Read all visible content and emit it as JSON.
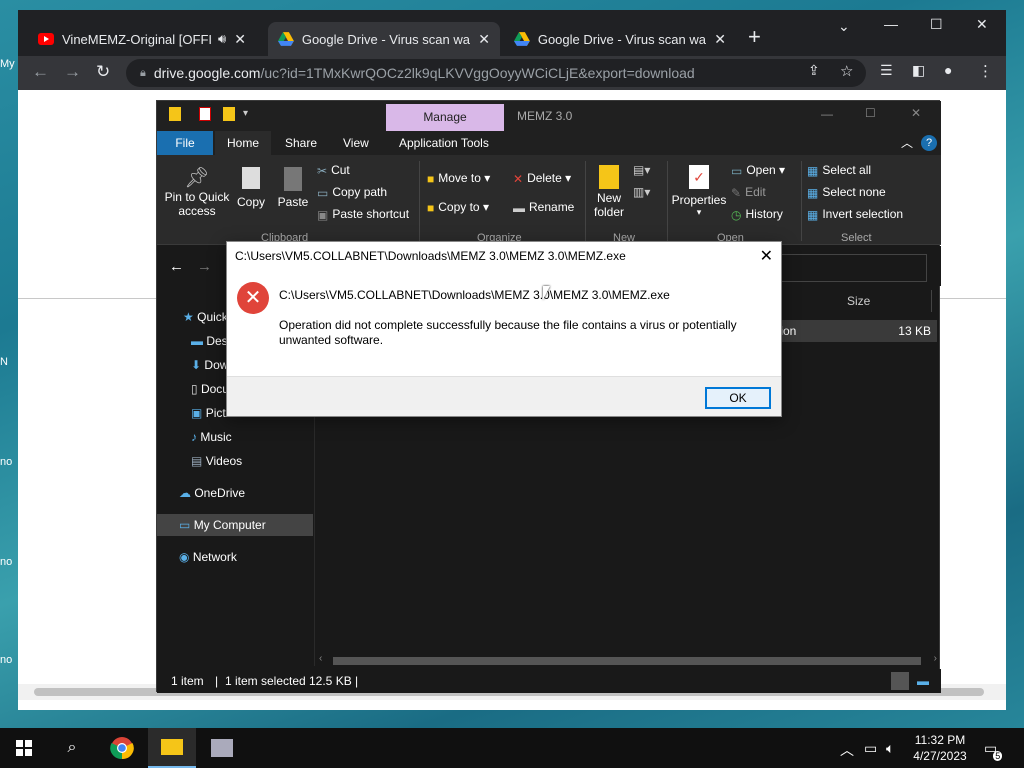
{
  "desktop": {
    "icon_labels": [
      "My",
      "N",
      "no",
      "no",
      "no"
    ]
  },
  "browser": {
    "tabs": [
      {
        "title": "VineMEMZ-Original [OFFICIAL",
        "icon": "youtube-icon",
        "audio": "speaker-icon"
      },
      {
        "title": "Google Drive - Virus scan warning",
        "icon": "google-drive-icon"
      },
      {
        "title": "Google Drive - Virus scan warning",
        "icon": "google-drive-icon"
      }
    ],
    "new_tab": "+",
    "url_host": "drive.google.com",
    "url_rest": "/uc?id=1TMxKwrQOCz2lk9qLKVVggOoyyWCiCLjE&export=download"
  },
  "explorer": {
    "title": "MEMZ 3.0",
    "manage_tab": "Manage",
    "tabs": [
      "File",
      "Home",
      "Share",
      "View",
      "Application Tools"
    ],
    "clipboard": {
      "pin": "Pin to Quick access",
      "pin_l1": "Pin to Quick",
      "pin_l2": "access",
      "copy": "Copy",
      "paste": "Paste",
      "cut": "Cut",
      "copy_path": "Copy path",
      "paste_shortcut": "Paste shortcut",
      "label": "Clipboard"
    },
    "organize": {
      "move_to": "Move to",
      "copy_to": "Copy to",
      "delete": "Delete",
      "rename": "Rename",
      "label": "Organize"
    },
    "new": {
      "new_folder_l1": "New",
      "new_folder_l2": "folder",
      "label": "New"
    },
    "open": {
      "properties": "Properties",
      "open": "Open",
      "edit": "Edit",
      "history": "History",
      "label": "Open"
    },
    "select": {
      "select_all": "Select all",
      "select_none": "Select none",
      "invert": "Invert selection",
      "label": "Select"
    },
    "sidebar": [
      {
        "label": "Quick access",
        "icon": "star-icon"
      },
      {
        "label": "Desktop",
        "icon": "desktop-icon"
      },
      {
        "label": "Downloads",
        "icon": "download-icon"
      },
      {
        "label": "Documents",
        "icon": "document-icon"
      },
      {
        "label": "Pictures",
        "icon": "picture-icon"
      },
      {
        "label": "Music",
        "icon": "music-icon"
      },
      {
        "label": "Videos",
        "icon": "video-icon"
      },
      {
        "label": "OneDrive",
        "icon": "cloud-icon"
      },
      {
        "label": "My Computer",
        "icon": "computer-icon"
      },
      {
        "label": "Network",
        "icon": "network-icon"
      }
    ],
    "columns": {
      "size": "Size"
    },
    "row": {
      "type_fragment": "tion",
      "size": "13 KB"
    },
    "status": {
      "items": "1 item",
      "selected": "1 item selected",
      "size": "12.5 KB"
    }
  },
  "dialog": {
    "title": "C:\\Users\\VM5.COLLABNET\\Downloads\\MEMZ 3.0\\MEMZ 3.0\\MEMZ.exe",
    "path": "C:\\Users\\VM5.COLLABNET\\Downloads\\MEMZ 3.0\\MEMZ 3.0\\MEMZ.exe",
    "message": "Operation did not complete successfully because the file contains a virus or potentially unwanted software.",
    "ok": "OK"
  },
  "taskbar": {
    "time": "11:32 PM",
    "date": "4/27/2023",
    "notifications": "5"
  },
  "colors": {
    "ribbon_file": "#1a6fb0",
    "manage": "#d9b8e8",
    "error": "#e0443a",
    "ok_border": "#0078d7"
  }
}
